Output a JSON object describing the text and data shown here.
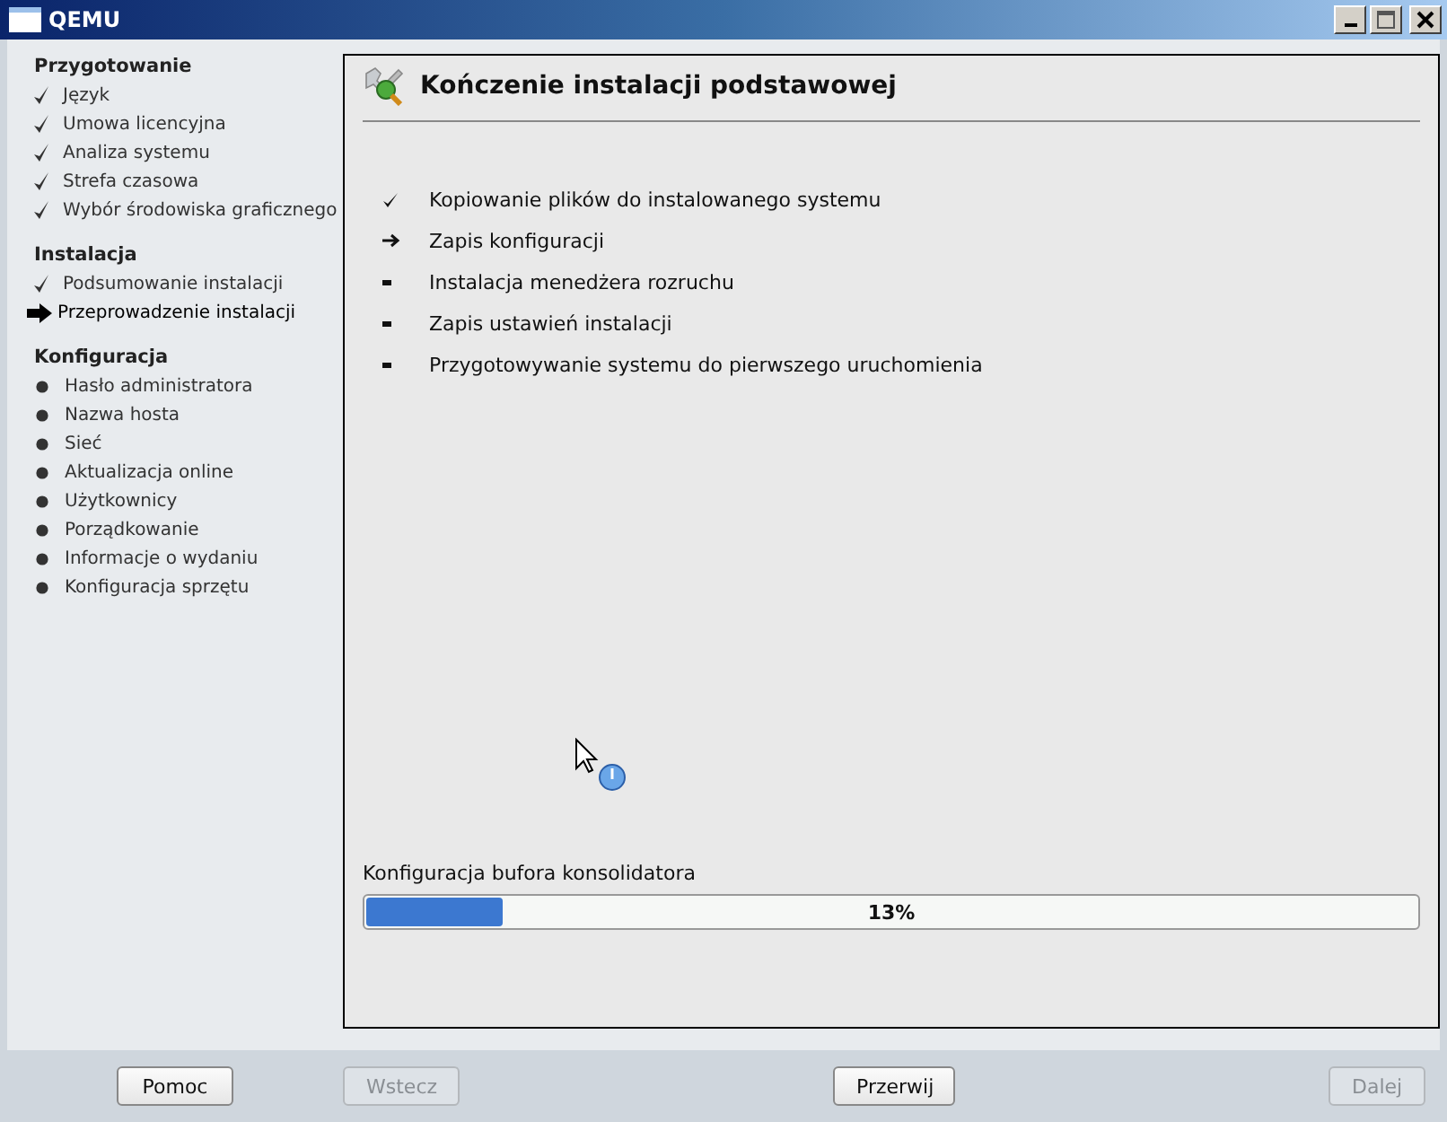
{
  "window": {
    "title": "QEMU"
  },
  "sidebar": {
    "sections": [
      {
        "title": "Przygotowanie",
        "items": [
          {
            "label": "Język",
            "kind": "done"
          },
          {
            "label": "Umowa licencyjna",
            "kind": "done"
          },
          {
            "label": "Analiza systemu",
            "kind": "done"
          },
          {
            "label": "Strefa czasowa",
            "kind": "done"
          },
          {
            "label": "Wybór środowiska graficznego",
            "kind": "done"
          }
        ]
      },
      {
        "title": "Instalacja",
        "items": [
          {
            "label": "Podsumowanie instalacji",
            "kind": "done"
          },
          {
            "label": "Przeprowadzenie instalacji",
            "kind": "current"
          }
        ]
      },
      {
        "title": "Konfiguracja",
        "items": [
          {
            "label": "Hasło administratora",
            "kind": "pending"
          },
          {
            "label": "Nazwa hosta",
            "kind": "pending"
          },
          {
            "label": "Sieć",
            "kind": "pending"
          },
          {
            "label": "Aktualizacja online",
            "kind": "pending"
          },
          {
            "label": "Użytkownicy",
            "kind": "pending"
          },
          {
            "label": "Porządkowanie",
            "kind": "pending"
          },
          {
            "label": "Informacje o wydaniu",
            "kind": "pending"
          },
          {
            "label": "Konfiguracja sprzętu",
            "kind": "pending"
          }
        ]
      }
    ]
  },
  "panel": {
    "title": "Kończenie instalacji podstawowej",
    "steps": [
      {
        "label": "Kopiowanie plików do instalowanego systemu",
        "kind": "done"
      },
      {
        "label": "Zapis konfiguracji",
        "kind": "current"
      },
      {
        "label": "Instalacja menedżera rozruchu",
        "kind": "pending"
      },
      {
        "label": "Zapis ustawień instalacji",
        "kind": "pending"
      },
      {
        "label": "Przygotowywanie systemu do pierwszego uruchomienia",
        "kind": "pending"
      }
    ],
    "progress": {
      "label": "Konfiguracja bufora konsolidatora",
      "level": 0.13,
      "reading": "13%"
    }
  },
  "buttons": [
    {
      "label": "Pomoc",
      "disabled": false
    },
    {
      "label": "Wstecz",
      "disabled": true
    },
    {
      "label": "Przerwij",
      "disabled": false
    },
    {
      "label": "Dalej",
      "disabled": true
    }
  ]
}
